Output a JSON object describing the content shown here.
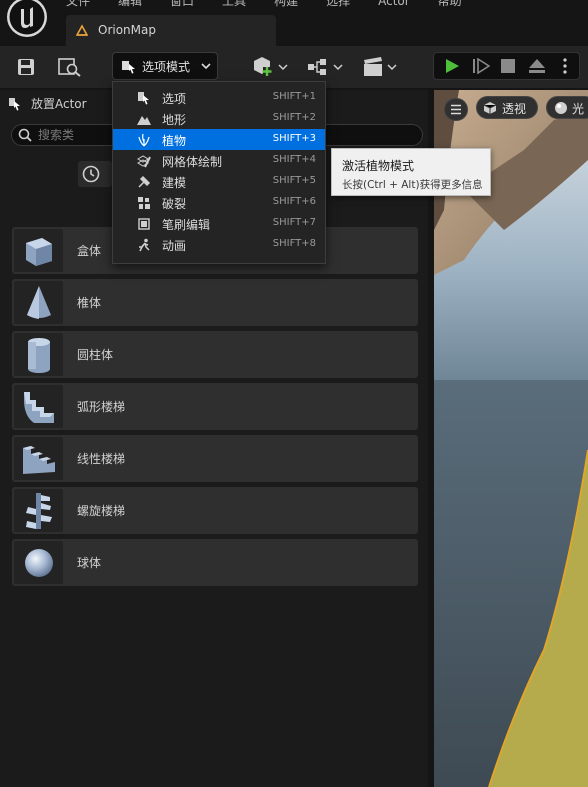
{
  "menu_bar": {
    "items": [
      "文件",
      "编辑",
      "窗口",
      "工具",
      "构建",
      "选择",
      "Actor",
      "帮助"
    ]
  },
  "tab": {
    "label": "OrionMap",
    "icon": "map-icon"
  },
  "toolbar": {
    "mode_button_label": "选项模式",
    "icons": [
      "save-icon",
      "content-browser-icon",
      "mode-icon",
      "add-actor-icon",
      "blueprint-icon",
      "cinematics-icon",
      "play-icon",
      "step-icon",
      "stop-icon",
      "eject-icon",
      "more-icon"
    ]
  },
  "dropdown": {
    "items": [
      {
        "label": "选项",
        "shortcut": "SHIFT+1",
        "icon": "select-icon"
      },
      {
        "label": "地形",
        "shortcut": "SHIFT+2",
        "icon": "landscape-icon"
      },
      {
        "label": "植物",
        "shortcut": "SHIFT+3",
        "icon": "foliage-icon",
        "active": true
      },
      {
        "label": "网格体绘制",
        "shortcut": "SHIFT+4",
        "icon": "mesh-paint-icon"
      },
      {
        "label": "建模",
        "shortcut": "SHIFT+5",
        "icon": "modeling-icon"
      },
      {
        "label": "破裂",
        "shortcut": "SHIFT+6",
        "icon": "fracture-icon"
      },
      {
        "label": "笔刷编辑",
        "shortcut": "SHIFT+7",
        "icon": "brush-edit-icon"
      },
      {
        "label": "动画",
        "shortcut": "SHIFT+8",
        "icon": "animation-icon"
      }
    ]
  },
  "tooltip": {
    "title": "激活植物模式",
    "hint": "长按(Ctrl + Alt)获得更多信息"
  },
  "place_actor_panel": {
    "title": "放置Actor",
    "search_placeholder": "搜索类",
    "items": [
      {
        "label": "盒体",
        "icon": "cube-icon"
      },
      {
        "label": "椎体",
        "icon": "cone-icon"
      },
      {
        "label": "圆柱体",
        "icon": "cylinder-icon"
      },
      {
        "label": "弧形楼梯",
        "icon": "curved-stairs-icon"
      },
      {
        "label": "线性楼梯",
        "icon": "linear-stairs-icon"
      },
      {
        "label": "螺旋楼梯",
        "icon": "spiral-stairs-icon"
      },
      {
        "label": "球体",
        "icon": "sphere-icon"
      }
    ]
  },
  "viewport": {
    "perspective_label": "透视",
    "lit_label": "光"
  }
}
